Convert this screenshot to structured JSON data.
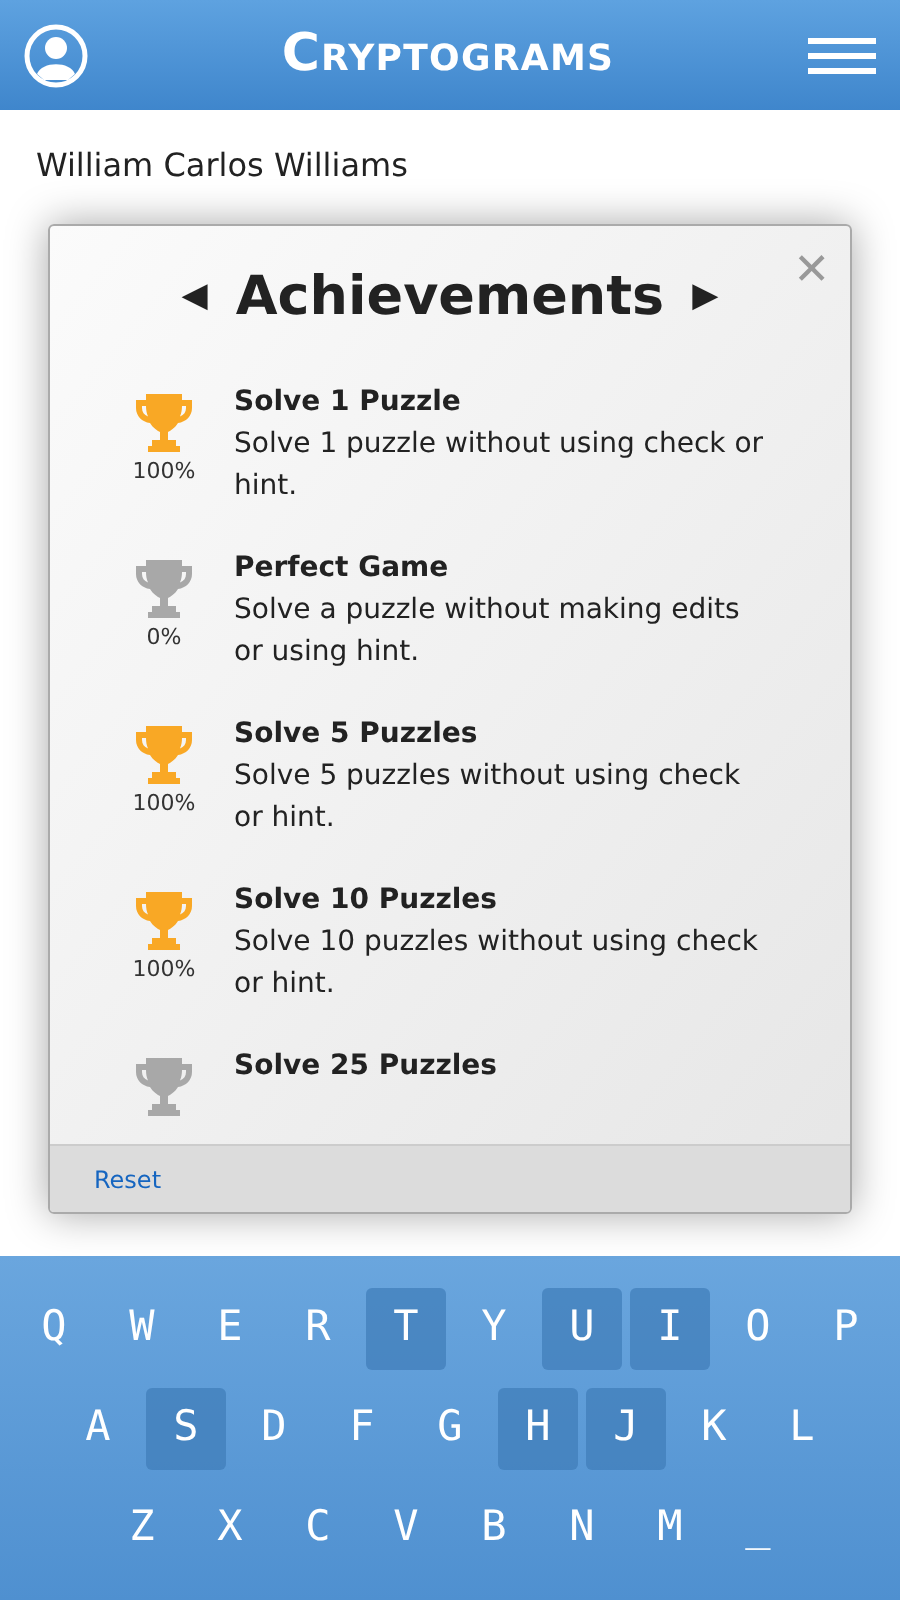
{
  "header": {
    "title": "Cryptograms"
  },
  "puzzle": {
    "author": "William Carlos Williams"
  },
  "dialog": {
    "title": "Achievements",
    "close": "✕",
    "prev": "◀",
    "next": "▶",
    "reset": "Reset",
    "achievements": [
      {
        "title": "Solve 1 Puzzle",
        "description": "Solve 1 puzzle without using check or hint.",
        "percent": "100%",
        "achieved": true
      },
      {
        "title": "Perfect Game",
        "description": "Solve a puzzle without making edits or using hint.",
        "percent": "0%",
        "achieved": false
      },
      {
        "title": "Solve 5 Puzzles",
        "description": "Solve 5 puzzles without using check or hint.",
        "percent": "100%",
        "achieved": true
      },
      {
        "title": "Solve 10 Puzzles",
        "description": "Solve 10 puzzles without using check or hint.",
        "percent": "100%",
        "achieved": true
      },
      {
        "title": "Solve 25 Puzzles",
        "achieved": false
      }
    ]
  },
  "keyboard": [
    [
      {
        "key": "Q",
        "used": false
      },
      {
        "key": "W",
        "used": false
      },
      {
        "key": "E",
        "used": false
      },
      {
        "key": "R",
        "used": false
      },
      {
        "key": "T",
        "used": true
      },
      {
        "key": "Y",
        "used": false
      },
      {
        "key": "U",
        "used": true
      },
      {
        "key": "I",
        "used": true
      },
      {
        "key": "O",
        "used": false
      },
      {
        "key": "P",
        "used": false
      }
    ],
    [
      {
        "key": "A",
        "used": false
      },
      {
        "key": "S",
        "used": true
      },
      {
        "key": "D",
        "used": false
      },
      {
        "key": "F",
        "used": false
      },
      {
        "key": "G",
        "used": false
      },
      {
        "key": "H",
        "used": true
      },
      {
        "key": "J",
        "used": true
      },
      {
        "key": "K",
        "used": false
      },
      {
        "key": "L",
        "used": false
      }
    ],
    [
      {
        "key": "Z",
        "used": false
      },
      {
        "key": "X",
        "used": false
      },
      {
        "key": "C",
        "used": false
      },
      {
        "key": "V",
        "used": false
      },
      {
        "key": "B",
        "used": false
      },
      {
        "key": "N",
        "used": false
      },
      {
        "key": "M",
        "used": false
      },
      {
        "key": "_",
        "used": false
      }
    ]
  ]
}
